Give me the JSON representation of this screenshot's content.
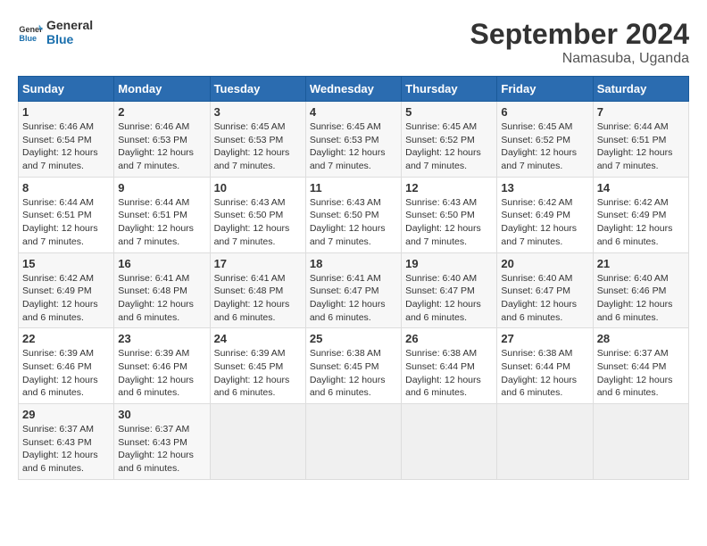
{
  "logo": {
    "text_general": "General",
    "text_blue": "Blue"
  },
  "title": "September 2024",
  "location": "Namasuba, Uganda",
  "headers": [
    "Sunday",
    "Monday",
    "Tuesday",
    "Wednesday",
    "Thursday",
    "Friday",
    "Saturday"
  ],
  "weeks": [
    [
      {
        "day": "1",
        "sunrise": "Sunrise: 6:46 AM",
        "sunset": "Sunset: 6:54 PM",
        "daylight": "Daylight: 12 hours and 7 minutes."
      },
      {
        "day": "2",
        "sunrise": "Sunrise: 6:46 AM",
        "sunset": "Sunset: 6:53 PM",
        "daylight": "Daylight: 12 hours and 7 minutes."
      },
      {
        "day": "3",
        "sunrise": "Sunrise: 6:45 AM",
        "sunset": "Sunset: 6:53 PM",
        "daylight": "Daylight: 12 hours and 7 minutes."
      },
      {
        "day": "4",
        "sunrise": "Sunrise: 6:45 AM",
        "sunset": "Sunset: 6:53 PM",
        "daylight": "Daylight: 12 hours and 7 minutes."
      },
      {
        "day": "5",
        "sunrise": "Sunrise: 6:45 AM",
        "sunset": "Sunset: 6:52 PM",
        "daylight": "Daylight: 12 hours and 7 minutes."
      },
      {
        "day": "6",
        "sunrise": "Sunrise: 6:45 AM",
        "sunset": "Sunset: 6:52 PM",
        "daylight": "Daylight: 12 hours and 7 minutes."
      },
      {
        "day": "7",
        "sunrise": "Sunrise: 6:44 AM",
        "sunset": "Sunset: 6:51 PM",
        "daylight": "Daylight: 12 hours and 7 minutes."
      }
    ],
    [
      {
        "day": "8",
        "sunrise": "Sunrise: 6:44 AM",
        "sunset": "Sunset: 6:51 PM",
        "daylight": "Daylight: 12 hours and 7 minutes."
      },
      {
        "day": "9",
        "sunrise": "Sunrise: 6:44 AM",
        "sunset": "Sunset: 6:51 PM",
        "daylight": "Daylight: 12 hours and 7 minutes."
      },
      {
        "day": "10",
        "sunrise": "Sunrise: 6:43 AM",
        "sunset": "Sunset: 6:50 PM",
        "daylight": "Daylight: 12 hours and 7 minutes."
      },
      {
        "day": "11",
        "sunrise": "Sunrise: 6:43 AM",
        "sunset": "Sunset: 6:50 PM",
        "daylight": "Daylight: 12 hours and 7 minutes."
      },
      {
        "day": "12",
        "sunrise": "Sunrise: 6:43 AM",
        "sunset": "Sunset: 6:50 PM",
        "daylight": "Daylight: 12 hours and 7 minutes."
      },
      {
        "day": "13",
        "sunrise": "Sunrise: 6:42 AM",
        "sunset": "Sunset: 6:49 PM",
        "daylight": "Daylight: 12 hours and 7 minutes."
      },
      {
        "day": "14",
        "sunrise": "Sunrise: 6:42 AM",
        "sunset": "Sunset: 6:49 PM",
        "daylight": "Daylight: 12 hours and 6 minutes."
      }
    ],
    [
      {
        "day": "15",
        "sunrise": "Sunrise: 6:42 AM",
        "sunset": "Sunset: 6:49 PM",
        "daylight": "Daylight: 12 hours and 6 minutes."
      },
      {
        "day": "16",
        "sunrise": "Sunrise: 6:41 AM",
        "sunset": "Sunset: 6:48 PM",
        "daylight": "Daylight: 12 hours and 6 minutes."
      },
      {
        "day": "17",
        "sunrise": "Sunrise: 6:41 AM",
        "sunset": "Sunset: 6:48 PM",
        "daylight": "Daylight: 12 hours and 6 minutes."
      },
      {
        "day": "18",
        "sunrise": "Sunrise: 6:41 AM",
        "sunset": "Sunset: 6:47 PM",
        "daylight": "Daylight: 12 hours and 6 minutes."
      },
      {
        "day": "19",
        "sunrise": "Sunrise: 6:40 AM",
        "sunset": "Sunset: 6:47 PM",
        "daylight": "Daylight: 12 hours and 6 minutes."
      },
      {
        "day": "20",
        "sunrise": "Sunrise: 6:40 AM",
        "sunset": "Sunset: 6:47 PM",
        "daylight": "Daylight: 12 hours and 6 minutes."
      },
      {
        "day": "21",
        "sunrise": "Sunrise: 6:40 AM",
        "sunset": "Sunset: 6:46 PM",
        "daylight": "Daylight: 12 hours and 6 minutes."
      }
    ],
    [
      {
        "day": "22",
        "sunrise": "Sunrise: 6:39 AM",
        "sunset": "Sunset: 6:46 PM",
        "daylight": "Daylight: 12 hours and 6 minutes."
      },
      {
        "day": "23",
        "sunrise": "Sunrise: 6:39 AM",
        "sunset": "Sunset: 6:46 PM",
        "daylight": "Daylight: 12 hours and 6 minutes."
      },
      {
        "day": "24",
        "sunrise": "Sunrise: 6:39 AM",
        "sunset": "Sunset: 6:45 PM",
        "daylight": "Daylight: 12 hours and 6 minutes."
      },
      {
        "day": "25",
        "sunrise": "Sunrise: 6:38 AM",
        "sunset": "Sunset: 6:45 PM",
        "daylight": "Daylight: 12 hours and 6 minutes."
      },
      {
        "day": "26",
        "sunrise": "Sunrise: 6:38 AM",
        "sunset": "Sunset: 6:44 PM",
        "daylight": "Daylight: 12 hours and 6 minutes."
      },
      {
        "day": "27",
        "sunrise": "Sunrise: 6:38 AM",
        "sunset": "Sunset: 6:44 PM",
        "daylight": "Daylight: 12 hours and 6 minutes."
      },
      {
        "day": "28",
        "sunrise": "Sunrise: 6:37 AM",
        "sunset": "Sunset: 6:44 PM",
        "daylight": "Daylight: 12 hours and 6 minutes."
      }
    ],
    [
      {
        "day": "29",
        "sunrise": "Sunrise: 6:37 AM",
        "sunset": "Sunset: 6:43 PM",
        "daylight": "Daylight: 12 hours and 6 minutes."
      },
      {
        "day": "30",
        "sunrise": "Sunrise: 6:37 AM",
        "sunset": "Sunset: 6:43 PM",
        "daylight": "Daylight: 12 hours and 6 minutes."
      },
      null,
      null,
      null,
      null,
      null
    ]
  ]
}
